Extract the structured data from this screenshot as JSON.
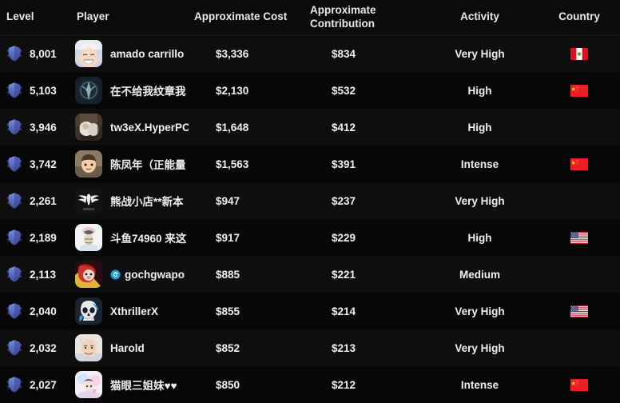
{
  "table": {
    "columns": [
      {
        "key": "level",
        "label": "Level"
      },
      {
        "key": "player",
        "label": "Player"
      },
      {
        "key": "cost",
        "label": "Approximate Cost"
      },
      {
        "key": "contrib",
        "label": "Approximate Contribution"
      },
      {
        "key": "activity",
        "label": "Activity"
      },
      {
        "key": "country",
        "label": "Country"
      }
    ],
    "rows": [
      {
        "level": "8,001",
        "player": "amado carrillo",
        "cost": "$3,336",
        "contribution": "$834",
        "activity": "Very High",
        "country": "Peru",
        "flag": "pe",
        "avatar": "anime-white-hair",
        "verified": false
      },
      {
        "level": "5,103",
        "player": "在不给我纹章我",
        "cost": "$2,130",
        "contribution": "$532",
        "activity": "High",
        "country": "China",
        "flag": "cn",
        "avatar": "dark-emblem",
        "verified": false
      },
      {
        "level": "3,946",
        "player": "tw3eX.HyperPC",
        "cost": "$1,648",
        "contribution": "$412",
        "activity": "High",
        "country": "",
        "flag": "none",
        "avatar": "photo-warm",
        "verified": false
      },
      {
        "level": "3,742",
        "player": "陈凤年（正能量",
        "cost": "$1,563",
        "contribution": "$391",
        "activity": "Intense",
        "country": "China",
        "flag": "cn",
        "avatar": "cartoon-boy",
        "verified": false
      },
      {
        "level": "2,261",
        "player": "熊战小店**新本",
        "cost": "$947",
        "contribution": "$237",
        "activity": "Very High",
        "country": "",
        "flag": "none",
        "avatar": "wings-logo",
        "verified": false
      },
      {
        "level": "2,189",
        "player": "斗鱼74960 来这",
        "cost": "$917",
        "contribution": "$229",
        "activity": "High",
        "country": "United States",
        "flag": "us",
        "avatar": "pale-sketch",
        "verified": false
      },
      {
        "level": "2,113",
        "player": "gochgwapo",
        "cost": "$885",
        "contribution": "$221",
        "activity": "Medium",
        "country": "",
        "flag": "none",
        "avatar": "red-hood-character",
        "verified": true
      },
      {
        "level": "2,040",
        "player": "XthrillerX",
        "cost": "$855",
        "contribution": "$214",
        "activity": "Very High",
        "country": "United States",
        "flag": "us",
        "avatar": "skull-blue",
        "verified": false
      },
      {
        "level": "2,032",
        "player": "Harold",
        "cost": "$852",
        "contribution": "$213",
        "activity": "Very High",
        "country": "",
        "flag": "none",
        "avatar": "hide-the-pain-harold",
        "verified": false
      },
      {
        "level": "2,027",
        "player": "猫眼三姐妹♥♥",
        "cost": "$850",
        "contribution": "$212",
        "activity": "Intense",
        "country": "China",
        "flag": "cn",
        "avatar": "anime-pastel",
        "verified": false
      }
    ]
  },
  "icons": {
    "level_badge": "winged-shield-icon",
    "verified": "verified-badge-icon"
  },
  "colors": {
    "background": "#050505",
    "row_odd": "#0e0e0e",
    "row_even": "#070707",
    "header_bg": "#0b0b0b",
    "text": "#f0f0f0",
    "badge_blue": "#5b72c8",
    "verified_blue": "#1a9fe0"
  }
}
